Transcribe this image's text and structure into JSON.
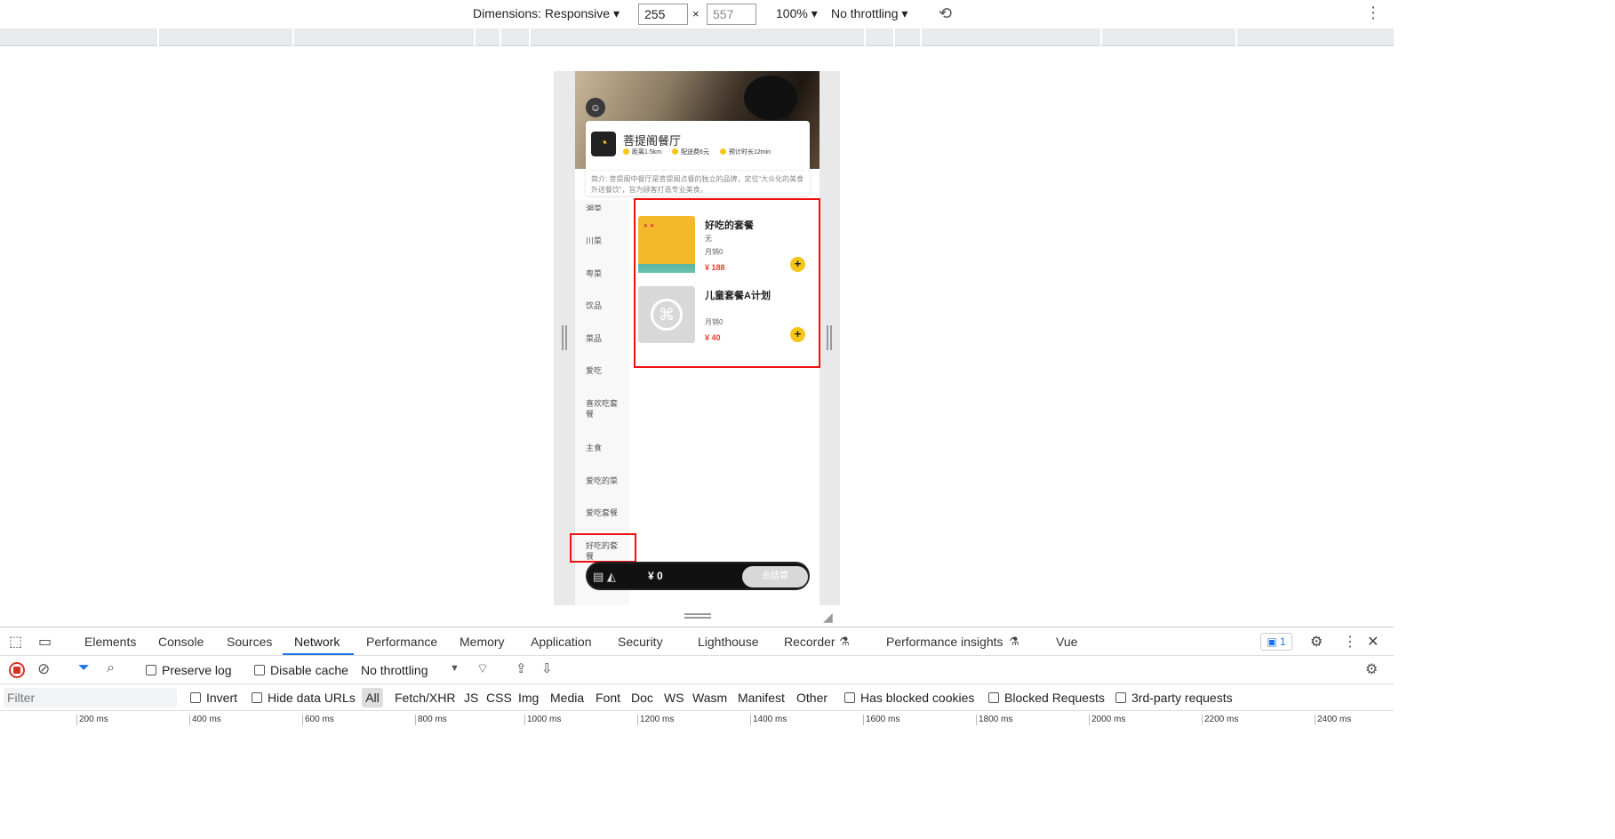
{
  "topbar": {
    "dimensions_label": "Dimensions: Responsive ▾",
    "width": "255",
    "height": "557",
    "x_sep": "×",
    "zoom": "100% ▾",
    "throttling": "No throttling ▾",
    "rotate_icon": "rotate-icon",
    "more_icon": "more-vertical-icon"
  },
  "app": {
    "shop_name": "菩提阁餐厅",
    "distance": "距离1.5km",
    "delivery_fee": "配送费6元",
    "eta": "预计时长12min",
    "description": "简介: 菩提阁中餐厅是菩提阁点餐的独立的品牌，定位“大众化的美食外送餐饮”，旨为顾客打造专业美食。",
    "categories": [
      "湘菜",
      "川菜",
      "粤菜",
      "饮品",
      "菜品",
      "爱吃",
      "喜欢吃套餐",
      "主食",
      "爱吃的菜",
      "爱吃套餐",
      "好吃的套餐"
    ],
    "goods": [
      {
        "title": "好吃的套餐",
        "desc": "无",
        "sales": "月销0",
        "price": "¥ 188"
      },
      {
        "title": "儿童套餐A计划",
        "desc": "",
        "sales": "月销0",
        "price": "¥ 40"
      }
    ],
    "cart_amount": "¥ 0",
    "checkout": "去结算"
  },
  "devtools": {
    "tabs": [
      "Elements",
      "Console",
      "Sources",
      "Network",
      "Performance",
      "Memory",
      "Application",
      "Security",
      "Lighthouse",
      "Recorder",
      "Performance insights",
      "Vue"
    ],
    "active_tab": "Network",
    "issues_count": "1",
    "preserve_log": "Preserve log",
    "disable_cache": "Disable cache",
    "throttling": "No throttling",
    "filter_placeholder": "Filter",
    "invert": "Invert",
    "hide_data_urls": "Hide data URLs",
    "types": [
      "All",
      "Fetch/XHR",
      "JS",
      "CSS",
      "Img",
      "Media",
      "Font",
      "Doc",
      "WS",
      "Wasm",
      "Manifest",
      "Other"
    ],
    "blocked_cookies": "Has blocked cookies",
    "blocked_requests": "Blocked Requests",
    "third_party": "3rd-party requests",
    "timeline": [
      "200 ms",
      "400 ms",
      "600 ms",
      "800 ms",
      "1000 ms",
      "1200 ms",
      "1400 ms",
      "1600 ms",
      "1800 ms",
      "2000 ms",
      "2200 ms",
      "2400 ms"
    ]
  },
  "colors": {
    "accent": "#1a73e8",
    "yellow": "#f5c518",
    "price": "#e5402b",
    "highlight": "#e11111"
  }
}
